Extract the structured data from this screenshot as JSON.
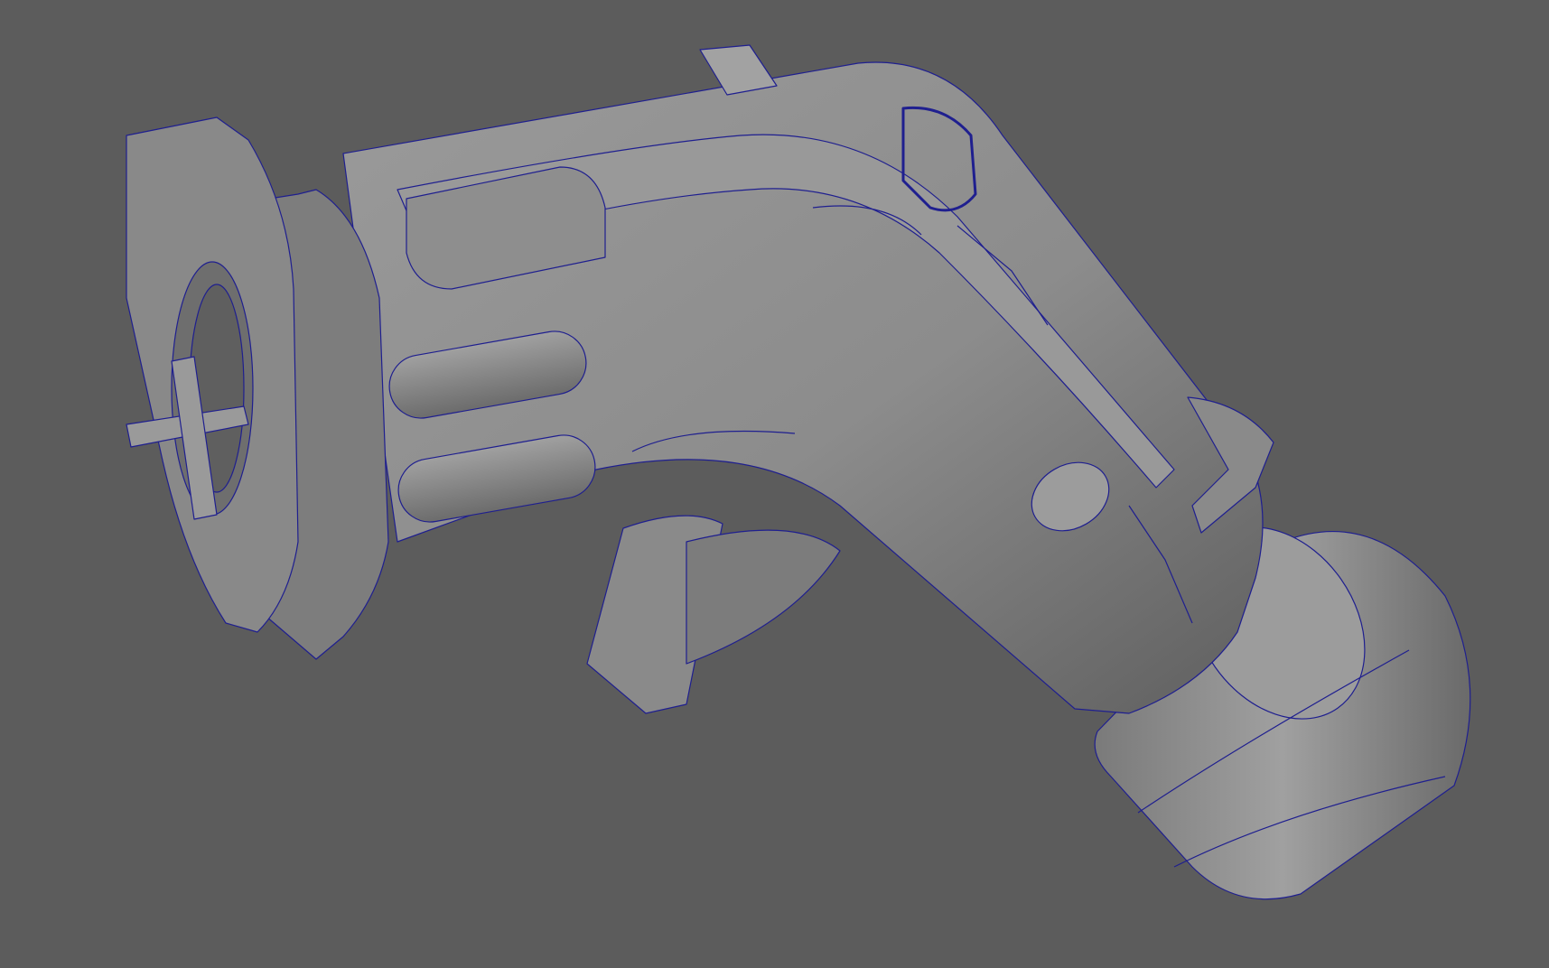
{
  "viewport": {
    "background_color": "#5c5c5c",
    "mesh_fill_color": "#8c8c8c",
    "mesh_shade_color": "#6f6f6f",
    "mesh_highlight_color": "#a4a4a4",
    "wireframe_color": "#1f1f8f",
    "subject": "ev-charging-connector-mesh"
  }
}
